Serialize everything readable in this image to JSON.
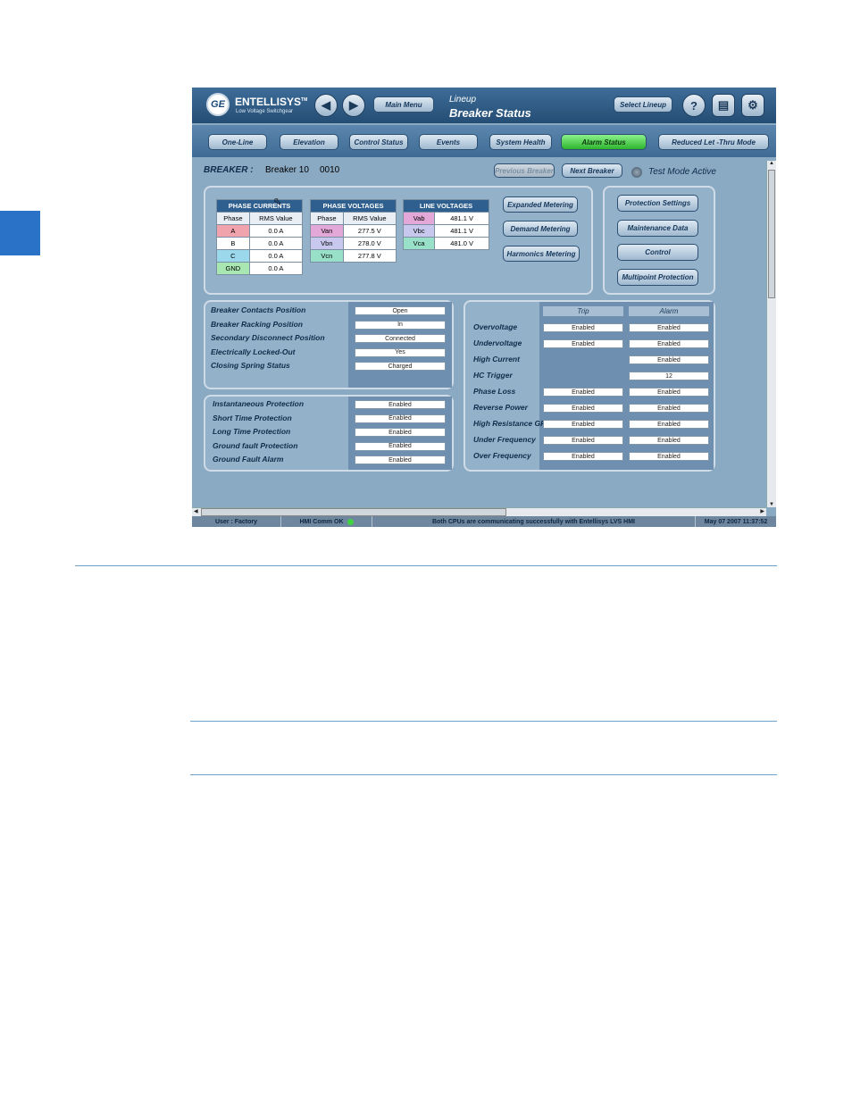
{
  "app": {
    "brand": "ENTELLISYS",
    "tm": "TM",
    "subtitle": "Low Voltage Switchgear",
    "logo": "GE"
  },
  "header": {
    "main_menu": "Main Menu",
    "title_small": "Lineup",
    "title": "Breaker Status",
    "select_lineup": "Select Lineup",
    "help": "?",
    "icons": [
      "back-icon",
      "forward-icon",
      "help-icon",
      "report-icon",
      "network-icon"
    ]
  },
  "nav": [
    "One-Line",
    "Elevation",
    "Control Status",
    "Events",
    "System Health",
    "Alarm Status",
    "Reduced Let -Thru Mode"
  ],
  "breaker": {
    "label": "BREAKER :",
    "name": "Breaker 10",
    "id": "0010",
    "prev": "Previous Breaker",
    "next": "Next Breaker",
    "test_mode": "Test Mode Active"
  },
  "phase_currents": {
    "title": "PHASE CURRENTS",
    "h1": "Phase",
    "h2": "RMS Value",
    "rows": [
      {
        "p": "A",
        "v": "0.0 A",
        "c": "#f1a3ad"
      },
      {
        "p": "B",
        "v": "0.0 A",
        "c": "#ffffff"
      },
      {
        "p": "C",
        "v": "0.0 A",
        "c": "#9cd8ec"
      },
      {
        "p": "GND",
        "v": "0.0 A",
        "c": "#a8e6b2"
      }
    ]
  },
  "phase_voltages": {
    "title": "PHASE VOLTAGES",
    "h1": "Phase",
    "h2": "RMS Value",
    "rows": [
      {
        "p": "Van",
        "v": "277.5 V",
        "c": "#e4a8d8"
      },
      {
        "p": "Vbn",
        "v": "278.0 V",
        "c": "#c8c8ee"
      },
      {
        "p": "Vcn",
        "v": "277.8 V",
        "c": "#98e0c8"
      }
    ]
  },
  "line_voltages": {
    "title": "LINE VOLTAGES",
    "rows": [
      {
        "p": "Vab",
        "v": "481.1 V",
        "c": "#e4a8d8"
      },
      {
        "p": "Vbc",
        "v": "481.1 V",
        "c": "#c8c8ee"
      },
      {
        "p": "Vca",
        "v": "481.0 V",
        "c": "#98e0c8"
      }
    ]
  },
  "metering": [
    "Expanded Metering",
    "Demand Metering",
    "Harmonics Metering"
  ],
  "side": [
    "Protection Settings",
    "Maintenance Data",
    "Control",
    "Multipoint Protection"
  ],
  "status_rows": [
    {
      "l": "Breaker Contacts Position",
      "v": "Open"
    },
    {
      "l": "Breaker Racking Position",
      "v": "In"
    },
    {
      "l": "Secondary Disconnect Position",
      "v": "Connected"
    },
    {
      "l": "Electrically Locked-Out",
      "v": "Yes"
    },
    {
      "l": "Closing Spring Status",
      "v": "Charged"
    }
  ],
  "protection_rows": [
    {
      "l": "Instantaneous Protection",
      "v": "Enabled"
    },
    {
      "l": "Short Time Protection",
      "v": "Enabled"
    },
    {
      "l": "Long Time Protection",
      "v": "Enabled"
    },
    {
      "l": "Ground fault Protection",
      "v": "Enabled"
    },
    {
      "l": "Ground Fault Alarm",
      "v": "Enabled"
    }
  ],
  "trip_alarm": {
    "h_trip": "Trip",
    "h_alarm": "Alarm",
    "rows": [
      {
        "l": "Overvoltage",
        "t": "Enabled",
        "a": "Enabled"
      },
      {
        "l": "Undervoltage",
        "t": "Enabled",
        "a": "Enabled"
      },
      {
        "l": "High Current",
        "t": "",
        "a": "Enabled"
      },
      {
        "l": "HC Trigger",
        "t": "",
        "a": "12"
      },
      {
        "l": "Phase Loss",
        "t": "Enabled",
        "a": "Enabled"
      },
      {
        "l": "Reverse Power",
        "t": "Enabled",
        "a": "Enabled"
      },
      {
        "l": "High Resistance GF",
        "t": "Enabled",
        "a": "Enabled"
      },
      {
        "l": "Under Frequency",
        "t": "Enabled",
        "a": "Enabled"
      },
      {
        "l": "Over Frequency",
        "t": "Enabled",
        "a": "Enabled"
      }
    ]
  },
  "statusbar": {
    "user": "User : Factory",
    "comm": "HMI Comm OK",
    "msg": "Both CPUs are communicating successfully with Entellisys LVS HMI",
    "time": "May 07 2007  11:37:52"
  }
}
